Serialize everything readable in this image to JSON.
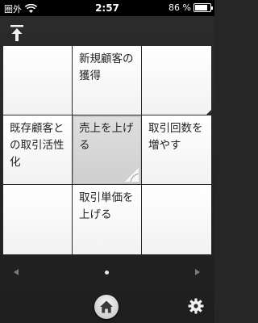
{
  "status_bar": {
    "carrier": "圏外",
    "time": "2:57",
    "battery_percent": "86 %",
    "battery_level": 0.86
  },
  "grid": {
    "cells": [
      {
        "label": ""
      },
      {
        "label": "新規顧客の獲得"
      },
      {
        "label": ""
      },
      {
        "label": "既存顧客との取引活性化"
      },
      {
        "label": "売上を上げる"
      },
      {
        "label": "取引回数を増やす"
      },
      {
        "label": ""
      },
      {
        "label": "取引単価を上げる"
      },
      {
        "label": ""
      }
    ]
  },
  "pager": {
    "page_count": 1,
    "current_page": 1
  },
  "icons": {
    "top": "upload-icon",
    "home": "home-icon",
    "settings": "gear-icon"
  },
  "colors": {
    "background": "#262626",
    "cell": "#ffffff",
    "selected_cell": "#d6d6d6"
  }
}
